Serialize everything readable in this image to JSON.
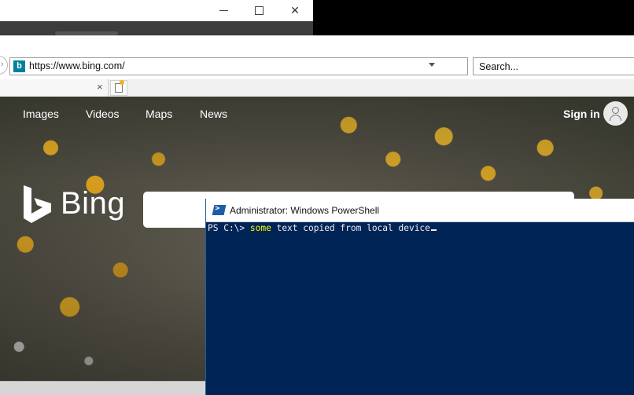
{
  "window_controls": {
    "minimize": "—",
    "maximize": "☐",
    "close": "✕"
  },
  "browser": {
    "address": {
      "url": "https://www.bing.com/",
      "favicon_letter": "b"
    },
    "search": {
      "placeholder": "Search..."
    },
    "tab": {
      "close": "×"
    }
  },
  "bing": {
    "nav": [
      "Images",
      "Videos",
      "Maps",
      "News"
    ],
    "signin": "Sign in",
    "logo": "Bing"
  },
  "powershell": {
    "title": "Administrator: Windows PowerShell",
    "prompt": "PS C:\\> ",
    "command": "some",
    "args": " text copied from local device",
    "colors": {
      "background": "#012456",
      "command": "#fbff00",
      "text": "#eeedf0"
    }
  }
}
